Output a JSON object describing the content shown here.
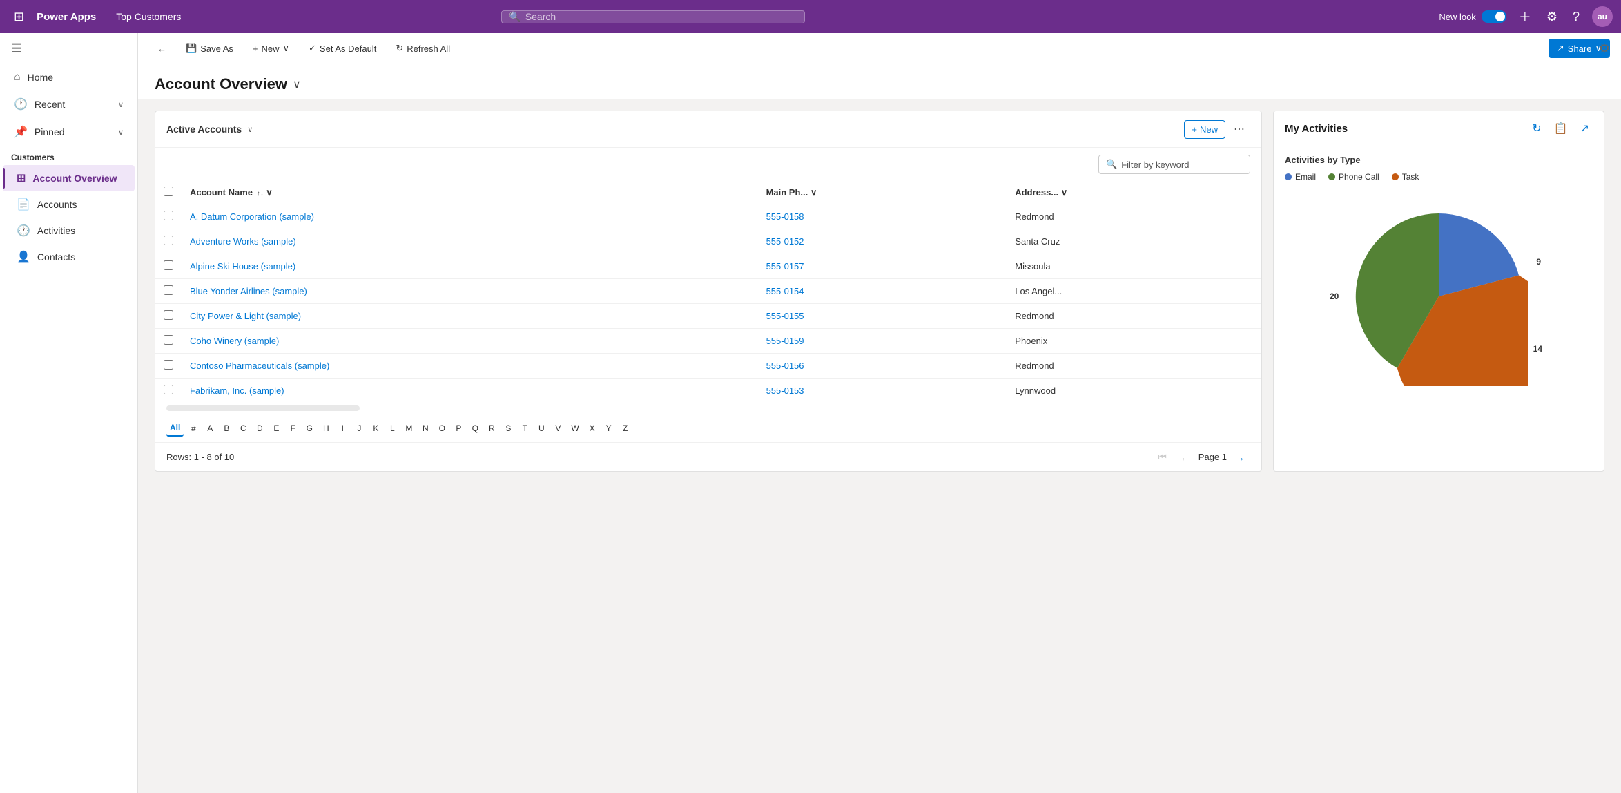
{
  "topNav": {
    "brand": "Power Apps",
    "appName": "Top Customers",
    "searchPlaceholder": "Search",
    "newLookLabel": "New look",
    "avatarText": "au"
  },
  "sidebar": {
    "menuIcon": "≡",
    "navItems": [
      {
        "id": "home",
        "label": "Home",
        "icon": "⌂"
      },
      {
        "id": "recent",
        "label": "Recent",
        "icon": "🕐",
        "chevron": "∨"
      },
      {
        "id": "pinned",
        "label": "Pinned",
        "icon": "📌",
        "chevron": "∨"
      }
    ],
    "sectionLabel": "Customers",
    "subItems": [
      {
        "id": "account-overview",
        "label": "Account Overview",
        "icon": "⊞",
        "active": true
      },
      {
        "id": "accounts",
        "label": "Accounts",
        "icon": "📄",
        "active": false
      },
      {
        "id": "activities",
        "label": "Activities",
        "icon": "🕐",
        "active": false
      },
      {
        "id": "contacts",
        "label": "Contacts",
        "icon": "👤",
        "active": false
      }
    ]
  },
  "toolbar": {
    "saveAsLabel": "Save As",
    "newLabel": "New",
    "setAsDefaultLabel": "Set As Default",
    "refreshAllLabel": "Refresh All",
    "shareLabel": "Share"
  },
  "pageHeader": {
    "title": "Account Overview"
  },
  "accountsCard": {
    "title": "Active Accounts",
    "newBtnLabel": "New",
    "filterPlaceholder": "Filter by keyword",
    "columns": [
      {
        "key": "name",
        "label": "Account Name"
      },
      {
        "key": "phone",
        "label": "Main Ph..."
      },
      {
        "key": "address",
        "label": "Address..."
      }
    ],
    "rows": [
      {
        "name": "A. Datum Corporation (sample)",
        "phone": "555-0158",
        "address": "Redmond"
      },
      {
        "name": "Adventure Works (sample)",
        "phone": "555-0152",
        "address": "Santa Cruz"
      },
      {
        "name": "Alpine Ski House (sample)",
        "phone": "555-0157",
        "address": "Missoula"
      },
      {
        "name": "Blue Yonder Airlines (sample)",
        "phone": "555-0154",
        "address": "Los Angel..."
      },
      {
        "name": "City Power & Light (sample)",
        "phone": "555-0155",
        "address": "Redmond"
      },
      {
        "name": "Coho Winery (sample)",
        "phone": "555-0159",
        "address": "Phoenix"
      },
      {
        "name": "Contoso Pharmaceuticals (sample)",
        "phone": "555-0156",
        "address": "Redmond"
      },
      {
        "name": "Fabrikam, Inc. (sample)",
        "phone": "555-0153",
        "address": "Lynnwood"
      }
    ],
    "alphaNav": [
      "All",
      "#",
      "A",
      "B",
      "C",
      "D",
      "E",
      "F",
      "G",
      "H",
      "I",
      "J",
      "K",
      "L",
      "M",
      "N",
      "O",
      "P",
      "Q",
      "R",
      "S",
      "T",
      "U",
      "V",
      "W",
      "X",
      "Y",
      "Z"
    ],
    "activeAlpha": "All",
    "rowsInfo": "Rows: 1 - 8 of 10",
    "pageLabel": "Page 1"
  },
  "activitiesCard": {
    "title": "My Activities",
    "chartSubtitle": "Activities by Type",
    "legend": [
      {
        "id": "email",
        "label": "Email",
        "color": "#4472c4"
      },
      {
        "id": "phone-call",
        "label": "Phone Call",
        "color": "#548235"
      },
      {
        "id": "task",
        "label": "Task",
        "color": "#c55a11"
      }
    ],
    "pieSlices": [
      {
        "id": "email",
        "value": 9,
        "color": "#4472c4",
        "labelClass": "label-9"
      },
      {
        "id": "task",
        "value": 20,
        "color": "#c55a11",
        "labelClass": "label-20"
      },
      {
        "id": "phone-call",
        "value": 14,
        "color": "#548235",
        "labelClass": "label-14"
      }
    ]
  }
}
